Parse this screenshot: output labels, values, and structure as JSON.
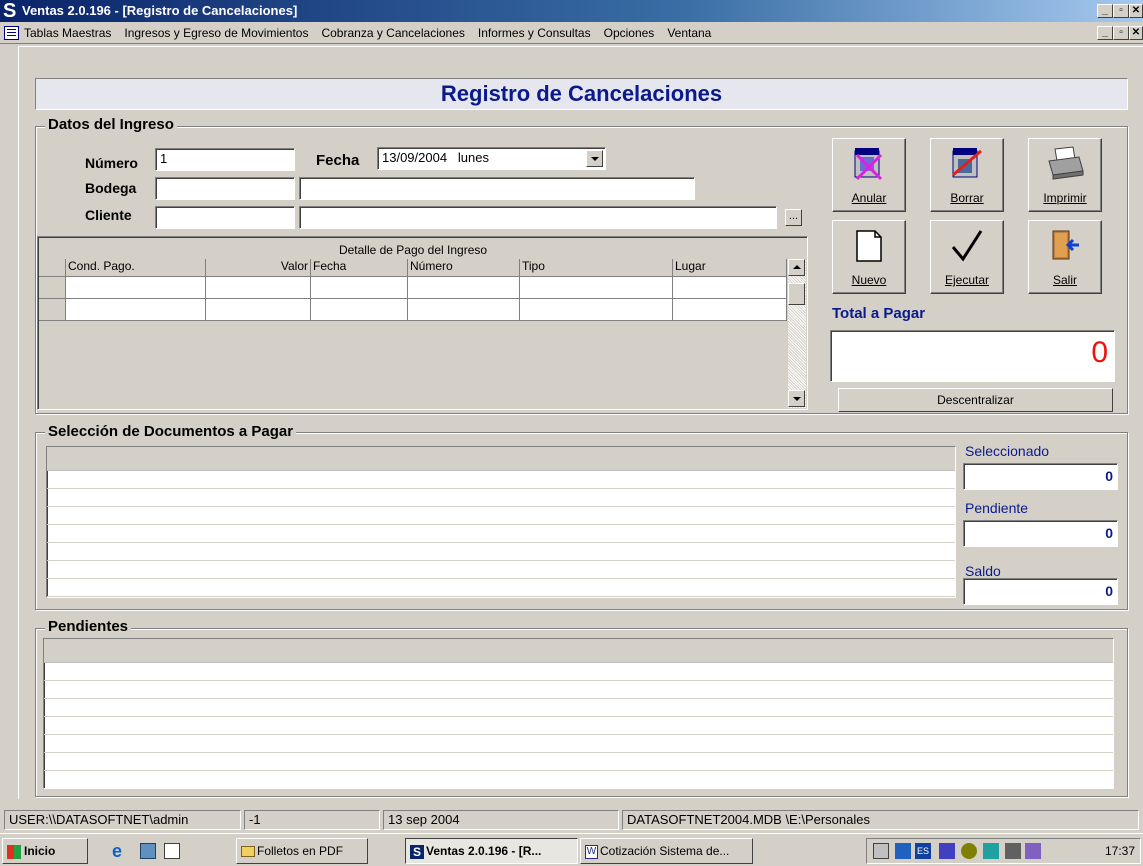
{
  "window": {
    "title": "Ventas 2.0.196 - [Registro de Cancelaciones]",
    "app_icon": "S",
    "min_label": "_",
    "max_label": "▫",
    "close_label": "✕"
  },
  "menubar": {
    "items": [
      "Tablas Maestras",
      "Ingresos y Egreso de Movimientos",
      "Cobranza y Cancelaciones",
      "Informes y Consultas",
      "Opciones",
      "Ventana"
    ]
  },
  "form": {
    "header": "Registro de Cancelaciones",
    "datos_ingreso": {
      "legend": "Datos del Ingreso",
      "numero_label": "Número",
      "numero_value": "1",
      "fecha_label": "Fecha",
      "fecha_value": "13/09/2004   lunes",
      "bodega_label": "Bodega",
      "bodega_code": "",
      "bodega_name": "",
      "cliente_label": "Cliente",
      "cliente_code": "",
      "cliente_name": "",
      "ellipsis_label": "..."
    },
    "detalle_pago": {
      "caption": "Detalle de Pago del Ingreso",
      "columns": [
        "Cond. Pago.",
        "Valor",
        "Fecha",
        "Número",
        "Tipo",
        "Lugar"
      ]
    },
    "buttons": {
      "anular": "Anular",
      "borrar": "Borrar",
      "imprimir": "Imprimir",
      "nuevo": "Nuevo",
      "ejecutar": "Ejecutar",
      "salir": "Salir",
      "descentralizar": "Descentralizar"
    },
    "total": {
      "label": "Total a Pagar",
      "value": "0"
    },
    "seleccion": {
      "legend": "Selección de Documentos a Pagar",
      "seleccionado_label": "Seleccionado",
      "seleccionado_value": "0",
      "pendiente_label": "Pendiente",
      "pendiente_value": "0",
      "saldo_label": "Saldo",
      "saldo_value": "0"
    },
    "pendientes": {
      "legend": "Pendientes"
    }
  },
  "statusbar": {
    "user": "USER:\\\\DATASOFTNET\\admin",
    "code": "-1",
    "blank": "",
    "date": "13 sep 2004",
    "db": "DATASOFTNET2004.MDB \\E:\\Personales"
  },
  "taskbar": {
    "start_label": "Inicio",
    "tasks": [
      "Folletos en PDF",
      "Ventas 2.0.196 - [R...",
      "Cotización Sistema de..."
    ],
    "clock": "17:37"
  },
  "colors": {
    "title_blue": "#0a246a",
    "header_text": "#0a1a8c",
    "total_red": "#f01010"
  }
}
